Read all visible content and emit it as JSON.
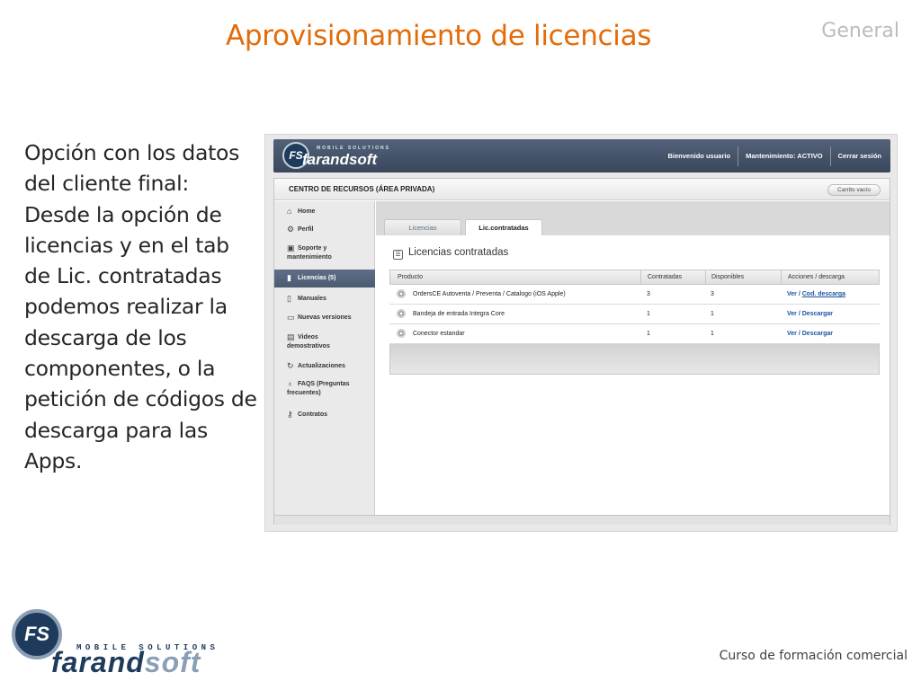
{
  "slide": {
    "title": "Aprovisionamiento de licencias",
    "section": "General",
    "body": "Opción con los datos del cliente final: Desde la opción de licencias y en el tab de Lic. contratadas podemos realizar la descarga de los componentes, o la petición de códigos de descarga para las Apps.",
    "footer": "Curso de formación comercial"
  },
  "logo": {
    "initials": "FS",
    "tagline": "MOBILE SOLUTIONS",
    "word_part1": "farand",
    "word_part2": "soft"
  },
  "app": {
    "header": {
      "logo_initials": "FS",
      "logo_tagline": "MOBILE SOLUTIONS",
      "logo_word": "farandsoft",
      "welcome": "Bienvenido usuario",
      "maintenance": "Mantenimiento: ACTIVO",
      "logout": "Cerrar sesión"
    },
    "bar_title": "CENTRO DE RECURSOS (ÁREA PRIVADA)",
    "cart": "Carrito vacío",
    "sidebar": [
      {
        "label": "Home",
        "icon": "home-icon"
      },
      {
        "label": "Perfil",
        "icon": "gear-icon"
      },
      {
        "label": "Soporte y mantenimiento",
        "icon": "support-icon"
      },
      {
        "label": "Licencias (5)",
        "icon": "license-icon"
      },
      {
        "label": "Manuales",
        "icon": "document-icon"
      },
      {
        "label": "Nuevas versiones",
        "icon": "folder-icon"
      },
      {
        "label": "Videos demostrativos",
        "icon": "video-icon"
      },
      {
        "label": "Actualizaciones",
        "icon": "refresh-icon"
      },
      {
        "label": "FAQS (Preguntas frecuentes)",
        "icon": "lightbulb-icon"
      },
      {
        "label": "Contratos",
        "icon": "key-icon"
      }
    ],
    "tabs": [
      "Licencias",
      "Lic.contratadas"
    ],
    "heading": "Licencias contratadas",
    "table": {
      "columns": [
        "Producto",
        "Contratadas",
        "Disponibles",
        "Acciones / descarga"
      ],
      "rows": [
        {
          "product": "OrdersCE Autoventa / Preventa / Catalogo (iOS Apple)",
          "contracted": "3",
          "available": "3",
          "action_view": "Ver",
          "action_sep": " / ",
          "action_other": "Cod. descarga"
        },
        {
          "product": "Bandeja de entrada Integra Core",
          "contracted": "1",
          "available": "1",
          "action_view": "Ver",
          "action_sep": " / ",
          "action_other": "Descargar"
        },
        {
          "product": "Conector estandar",
          "contracted": "1",
          "available": "1",
          "action_view": "Ver",
          "action_sep": " / ",
          "action_other": "Descargar"
        }
      ]
    }
  }
}
